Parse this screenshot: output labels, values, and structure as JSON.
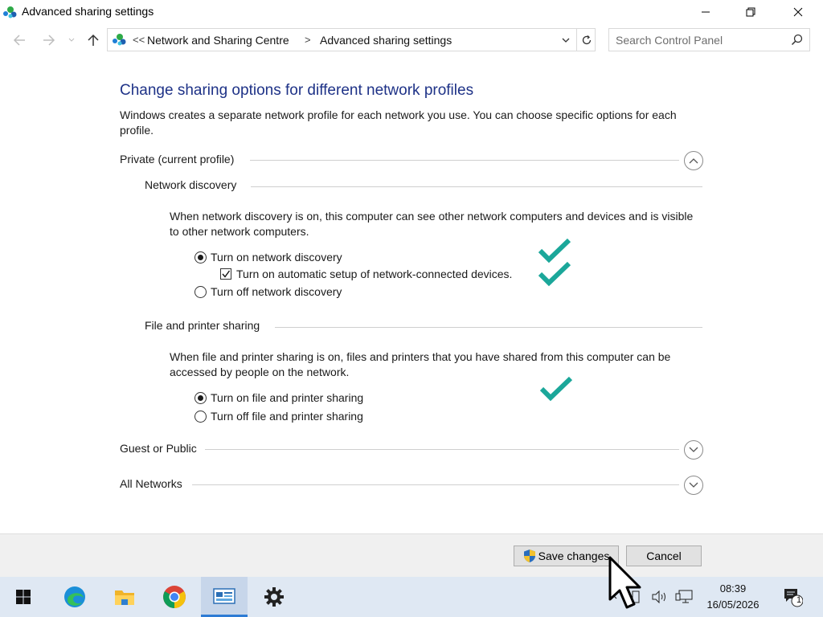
{
  "window": {
    "title": "Advanced sharing settings"
  },
  "address": {
    "prefix": "<<",
    "crumbs": [
      "Network and Sharing Centre",
      "Advanced sharing settings"
    ],
    "separator": ">"
  },
  "search": {
    "placeholder": "Search Control Panel"
  },
  "content": {
    "heading": "Change sharing options for different network profiles",
    "intro": "Windows creates a separate network profile for each network you use. You can choose specific options for each profile.",
    "private_profile": {
      "label": "Private (current profile)",
      "expanded": true,
      "network_discovery": {
        "label": "Network discovery",
        "description": "When network discovery is on, this computer can see other network computers and devices and is visible to other network computers.",
        "option_on": "Turn on network discovery",
        "option_auto_setup": "Turn on automatic setup of network-connected devices.",
        "option_off": "Turn off network discovery",
        "selected": "on",
        "auto_setup_checked": true
      },
      "file_printer_sharing": {
        "label": "File and printer sharing",
        "description": "When file and printer sharing is on, files and printers that you have shared from this computer can be accessed by people on the network.",
        "option_on": "Turn on file and printer sharing",
        "option_off": "Turn off file and printer sharing",
        "selected": "on"
      }
    },
    "guest_public": {
      "label": "Guest or Public",
      "expanded": false
    },
    "all_networks": {
      "label": "All Networks",
      "expanded": false
    }
  },
  "buttons": {
    "save": "Save changes",
    "cancel": "Cancel"
  },
  "taskbar": {
    "pinned": [
      "start-icon",
      "edge-icon",
      "file-explorer-icon",
      "chrome-icon",
      "control-panel-icon",
      "settings-icon"
    ],
    "active": "control-panel-icon",
    "time": "08:39",
    "date": "16/05/2026",
    "notification_count": "1"
  },
  "colors": {
    "heading": "#1e3287",
    "tick": "#1ba79a",
    "taskbar": "#dfe8f3",
    "accent": "#2d7bd4"
  }
}
